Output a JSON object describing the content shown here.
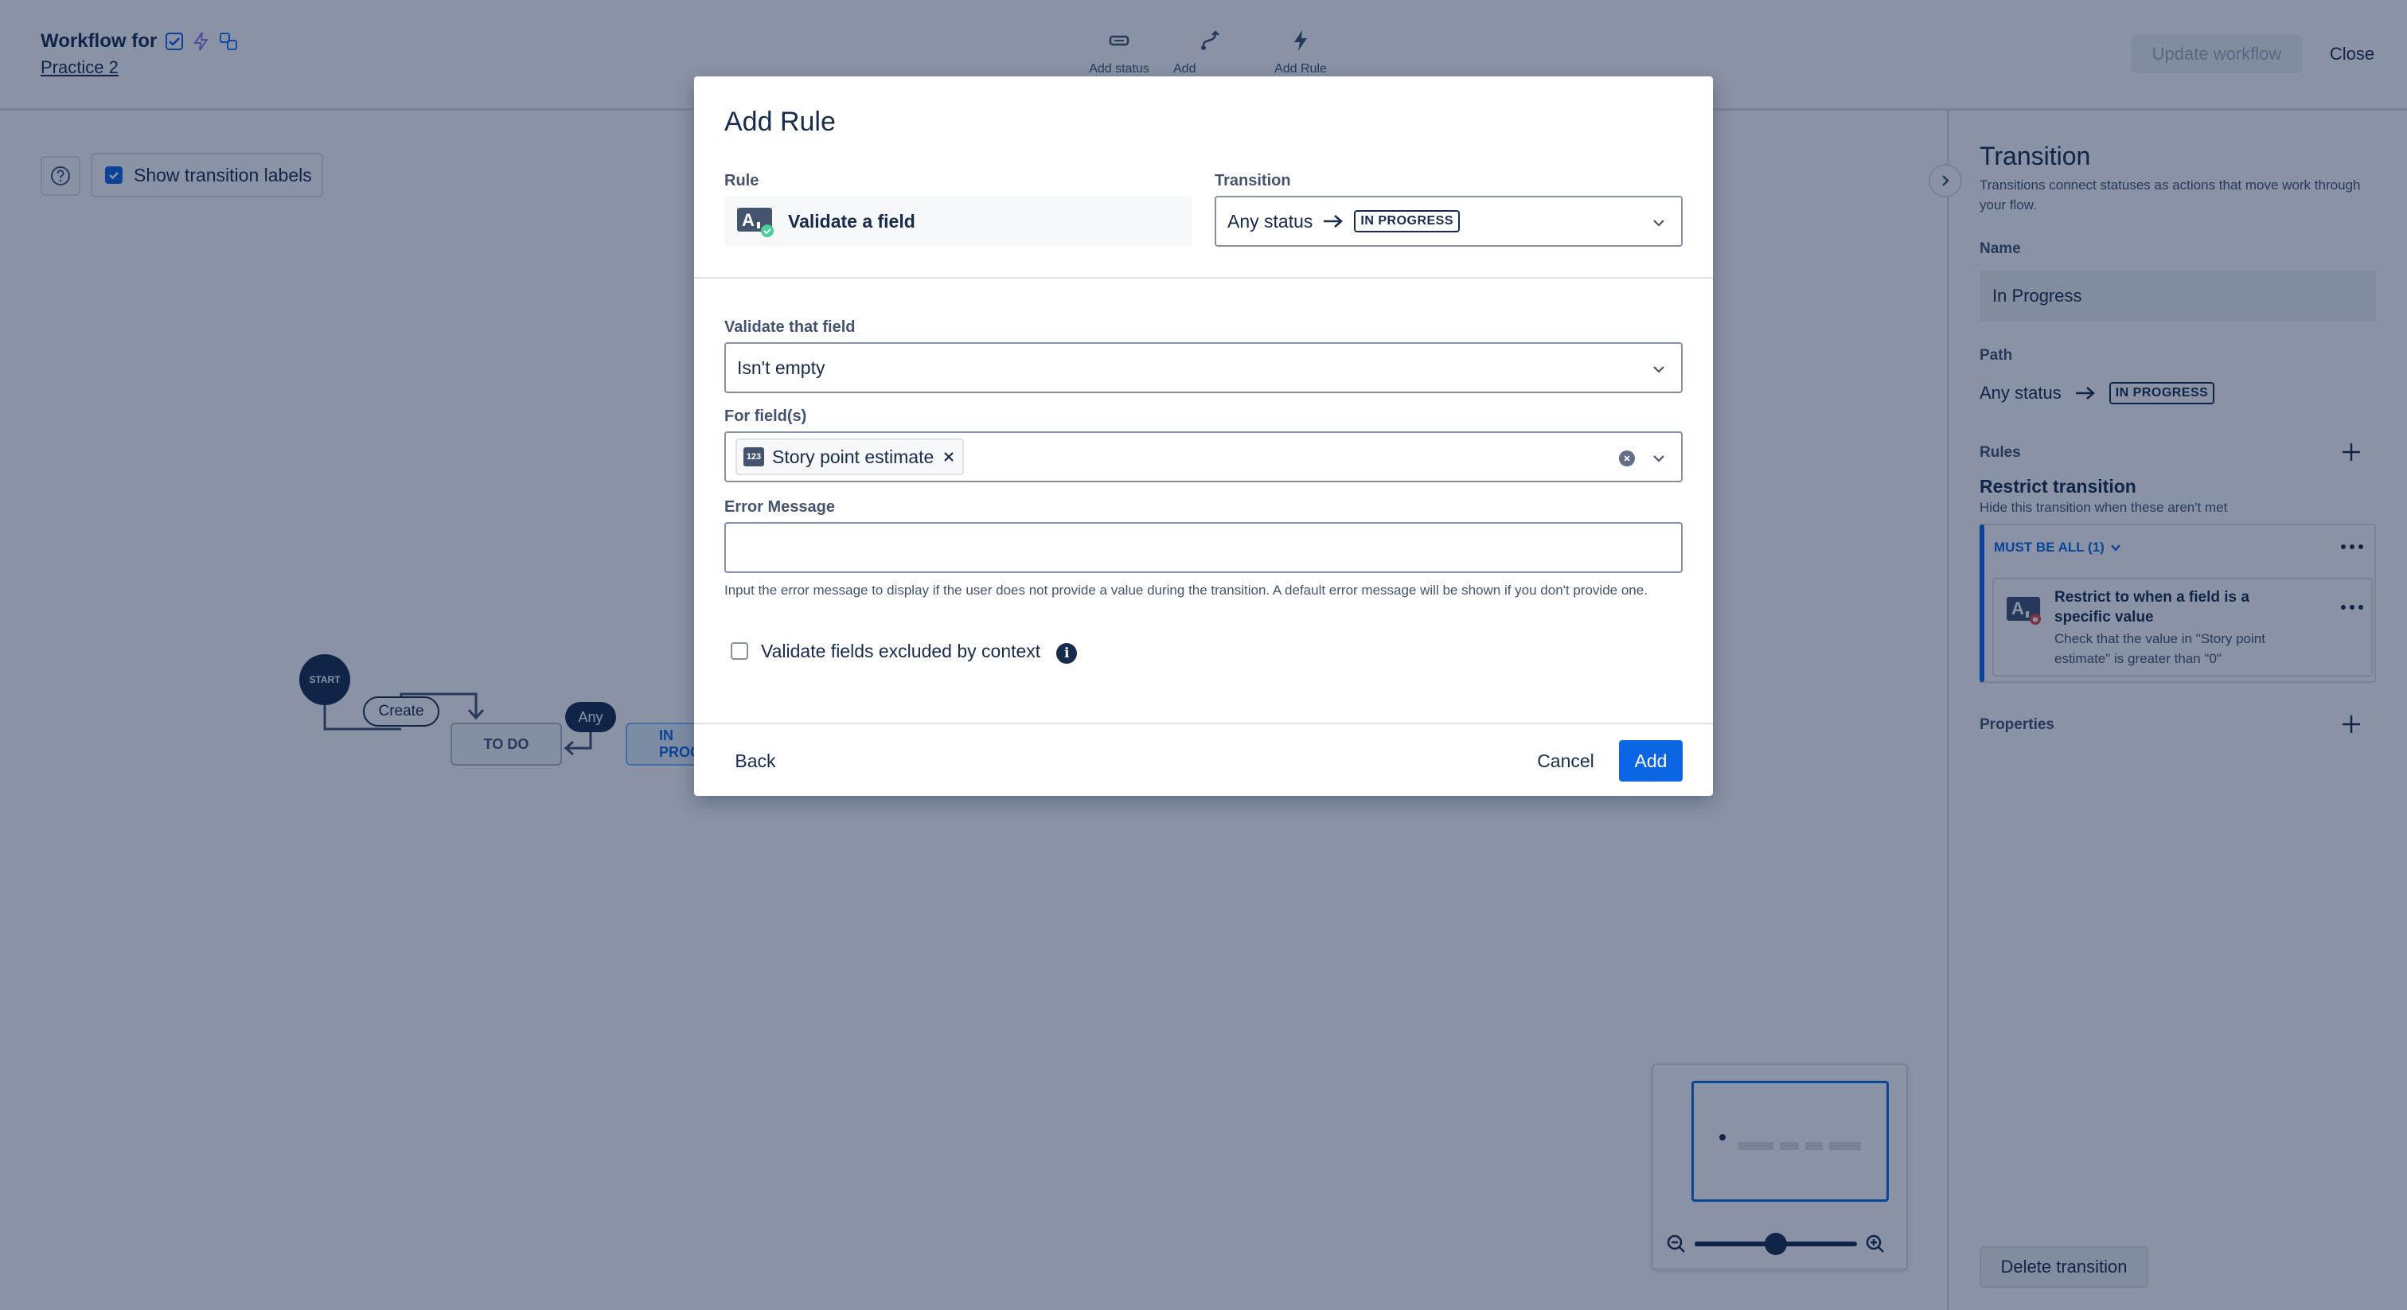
{
  "header": {
    "title": "Workflow for",
    "project_link": "Practice 2",
    "toolbar": [
      {
        "label": "Add status",
        "icon": "status-icon"
      },
      {
        "label": "Add Transition",
        "icon": "transition-icon"
      },
      {
        "label": "Add Rule",
        "icon": "lightning-icon"
      }
    ],
    "update_button": "Update workflow",
    "close_button": "Close"
  },
  "canvas": {
    "show_labels": "Show transition labels",
    "nodes": {
      "start": "START",
      "create": "Create",
      "any": "Any",
      "todo": "TO DO",
      "in_progress": "IN PROGRESS"
    }
  },
  "panel": {
    "title": "Transition",
    "description": "Transitions connect statuses as actions that move work through your flow.",
    "name_label": "Name",
    "name_value": "In Progress",
    "path_label": "Path",
    "path_from": "Any status",
    "path_to": "IN PROGRESS",
    "rules_label": "Rules",
    "rule_title": "Restrict transition",
    "rule_subtitle": "Hide this transition when these aren't met",
    "group_label": "MUST BE ALL (1)",
    "card_title": "Restrict to when a field is a specific value",
    "card_desc": "Check that the value in \"Story point estimate\" is greater than \"0\"",
    "properties_label": "Properties",
    "delete_button": "Delete transition"
  },
  "modal": {
    "title": "Add Rule",
    "rule_label": "Rule",
    "rule_value": "Validate a field",
    "transition_label": "Transition",
    "transition_from": "Any status",
    "transition_to": "IN PROGRESS",
    "validate_label": "Validate that field",
    "validate_value": "Isn't empty",
    "fields_label": "For field(s)",
    "field_tag": "Story point estimate",
    "field_tag_icon": "123",
    "error_label": "Error Message",
    "error_value": "",
    "helper": "Input the error message to display if the user does not provide a value during the transition. A default error message will be shown if you don't provide one.",
    "checkbox_label": "Validate fields excluded by context",
    "back": "Back",
    "cancel": "Cancel",
    "add": "Add"
  },
  "zoom": {
    "level": 0.5
  },
  "colors": {
    "accent": "#0c66e4",
    "overlay": "rgba(9,30,66,0.48)"
  }
}
